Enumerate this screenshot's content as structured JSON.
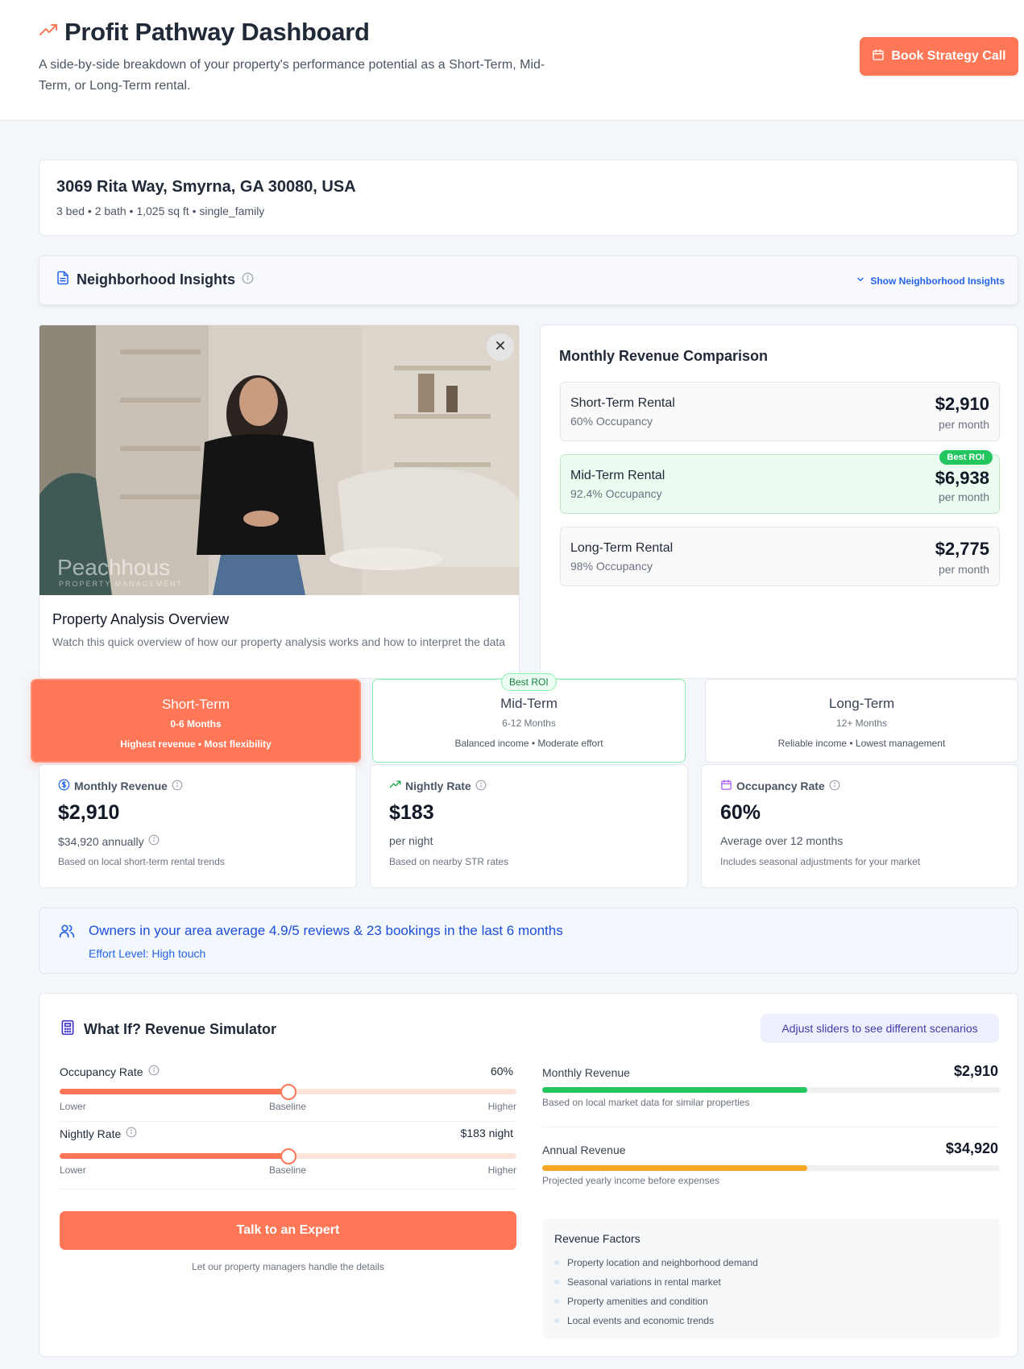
{
  "header": {
    "title": "Profit Pathway Dashboard",
    "subtitle": "A side-by-side breakdown of your property's performance potential as a Short-Term, Mid-Term, or Long-Term rental.",
    "book_button": "Book Strategy Call"
  },
  "property": {
    "address": "3069 Rita Way, Smyrna, GA 30080, USA",
    "details": "3 bed • 2 bath • 1,025 sq ft • single_family"
  },
  "insights": {
    "label": "Neighborhood Insights",
    "toggle": "Show Neighborhood Insights"
  },
  "video": {
    "watermark": "Peachhous",
    "watermark_sub": "PROPERTY MANAGEMENT",
    "title": "Property Analysis Overview",
    "description": "Watch this quick overview of how our property analysis works and how to interpret the data"
  },
  "revenue_comparison": {
    "title": "Monthly Revenue Comparison",
    "rows": [
      {
        "name": "Short-Term Rental",
        "occupancy": "60% Occupancy",
        "amount": "$2,910",
        "per": "per month"
      },
      {
        "name": "Mid-Term Rental",
        "occupancy": "92.4% Occupancy",
        "amount": "$6,938",
        "per": "per month",
        "badge": "Best ROI"
      },
      {
        "name": "Long-Term Rental",
        "occupancy": "98% Occupancy",
        "amount": "$2,775",
        "per": "per month"
      }
    ]
  },
  "terms": {
    "best_roi_label": "Best ROI",
    "items": [
      {
        "title": "Short-Term",
        "duration": "0-6 Months",
        "features": "Highest revenue • Most flexibility"
      },
      {
        "title": "Mid-Term",
        "duration": "6-12 Months",
        "features": "Balanced income • Moderate effort"
      },
      {
        "title": "Long-Term",
        "duration": "12+ Months",
        "features": "Reliable income • Lowest management"
      }
    ]
  },
  "metrics": {
    "monthly": {
      "label": "Monthly Revenue",
      "value": "$2,910",
      "sub": "$34,920 annually",
      "note": "Based on local short-term rental trends"
    },
    "nightly": {
      "label": "Nightly Rate",
      "value": "$183",
      "sub": "per night",
      "note": "Based on nearby STR rates"
    },
    "occupancy": {
      "label": "Occupancy Rate",
      "value": "60%",
      "sub": "Average over 12 months",
      "note": "Includes seasonal adjustments for your market"
    }
  },
  "owners": {
    "text": "Owners in your area average 4.9/5 reviews & 23 bookings in the last 6 months",
    "effort": "Effort Level: High touch"
  },
  "simulator": {
    "title": "What If? Revenue Simulator",
    "hint": "Adjust sliders to see different scenarios",
    "occupancy": {
      "label": "Occupancy Rate",
      "value": "60%",
      "position": 0.5
    },
    "nightly": {
      "label": "Nightly Rate",
      "value": "$183 night",
      "position": 0.5
    },
    "scale": {
      "low": "Lower",
      "mid": "Baseline",
      "high": "Higher"
    },
    "expert_button": "Talk to an Expert",
    "expert_note": "Let our property managers handle the details",
    "monthly": {
      "label": "Monthly Revenue",
      "value": "$2,910",
      "note": "Based on local market data for similar properties",
      "fill": 0.58
    },
    "annual": {
      "label": "Annual Revenue",
      "value": "$34,920",
      "note": "Projected yearly income before expenses",
      "fill": 0.58
    },
    "factors": {
      "title": "Revenue Factors",
      "items": [
        "Property location and neighborhood demand",
        "Seasonal variations in rental market",
        "Property amenities and condition",
        "Local events and economic trends"
      ]
    }
  },
  "colors": {
    "accent": "#ff7757",
    "success": "#22c55e",
    "annual_bar": "#f5a623",
    "link": "#2563eb"
  }
}
